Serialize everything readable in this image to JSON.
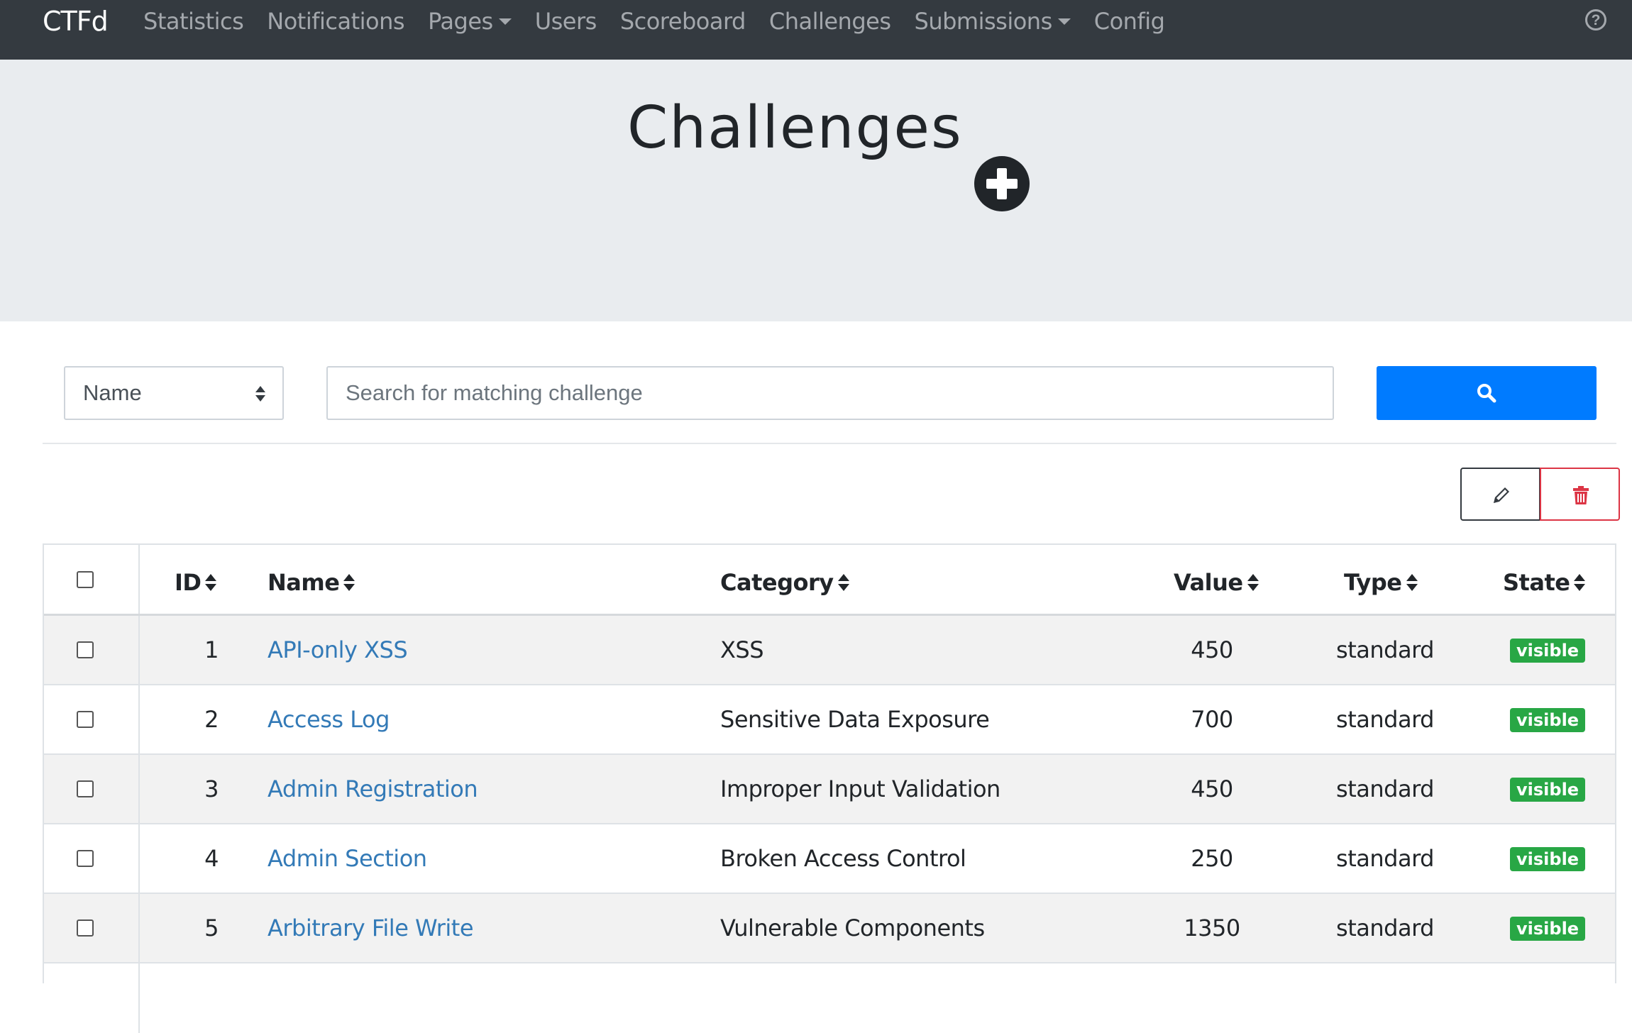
{
  "nav": {
    "brand": "CTFd",
    "items": [
      {
        "label": "Statistics",
        "dropdown": false
      },
      {
        "label": "Notifications",
        "dropdown": false
      },
      {
        "label": "Pages",
        "dropdown": true
      },
      {
        "label": "Users",
        "dropdown": false
      },
      {
        "label": "Scoreboard",
        "dropdown": false
      },
      {
        "label": "Challenges",
        "dropdown": false
      },
      {
        "label": "Submissions",
        "dropdown": true
      },
      {
        "label": "Config",
        "dropdown": false
      }
    ],
    "help_icon": "question-circle-icon",
    "help_glyph": "?"
  },
  "header": {
    "title": "Challenges",
    "add_icon": "plus-circle-icon"
  },
  "search": {
    "field_selected": "Name",
    "placeholder": "Search for matching challenge",
    "value": "",
    "button_icon": "search-icon",
    "accent": "#007bff"
  },
  "actions": {
    "edit_icon": "pencil-icon",
    "delete_icon": "trash-icon",
    "delete_color": "#dc3545"
  },
  "table": {
    "columns": [
      "ID",
      "Name",
      "Category",
      "Value",
      "Type",
      "State"
    ],
    "rows": [
      {
        "id": "1",
        "name": "API-only XSS",
        "category": "XSS",
        "value": "450",
        "type": "standard",
        "state": "visible"
      },
      {
        "id": "2",
        "name": "Access Log",
        "category": "Sensitive Data Exposure",
        "value": "700",
        "type": "standard",
        "state": "visible"
      },
      {
        "id": "3",
        "name": "Admin Registration",
        "category": "Improper Input Validation",
        "value": "450",
        "type": "standard",
        "state": "visible"
      },
      {
        "id": "4",
        "name": "Admin Section",
        "category": "Broken Access Control",
        "value": "250",
        "type": "standard",
        "state": "visible"
      },
      {
        "id": "5",
        "name": "Arbitrary File Write",
        "category": "Vulnerable Components",
        "value": "1350",
        "type": "standard",
        "state": "visible"
      }
    ],
    "link_color": "#337ab7",
    "badge_color": "#28a745"
  }
}
